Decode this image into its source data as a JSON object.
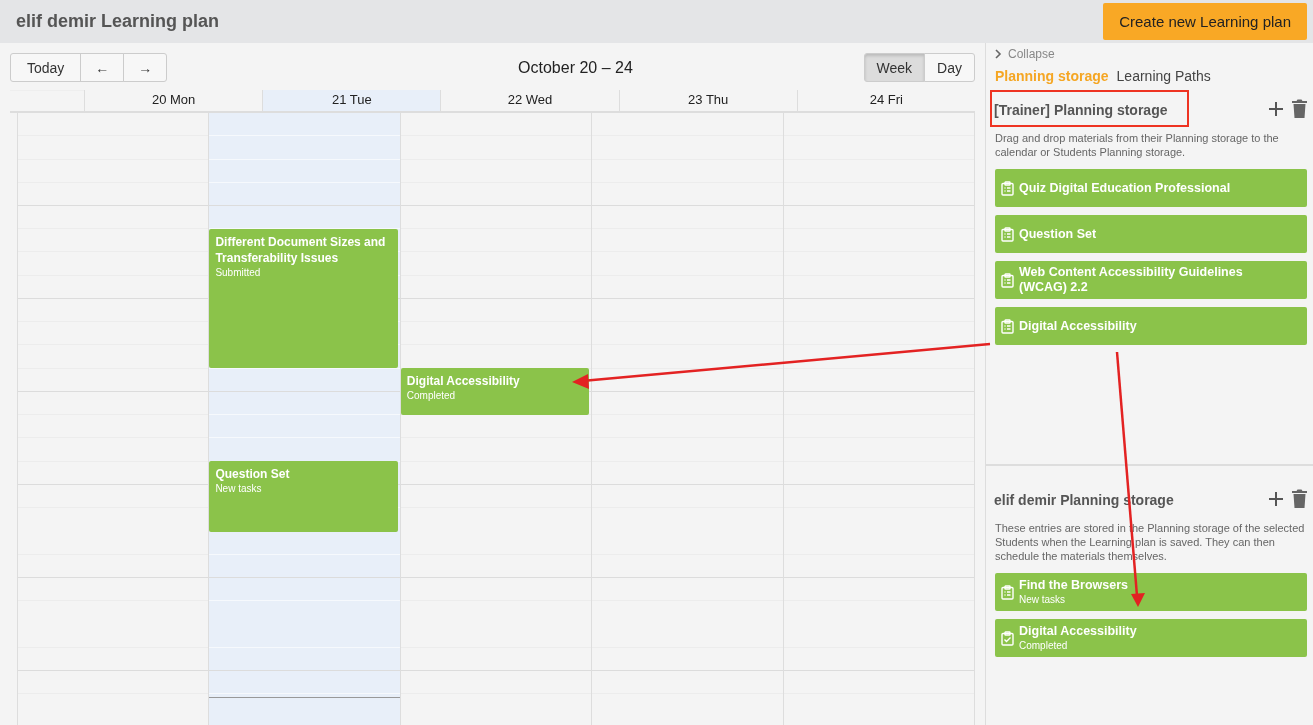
{
  "header": {
    "title": "elif demir Learning plan",
    "create_button": "Create new Learning plan"
  },
  "calendar": {
    "nav_buttons": [
      "Today",
      "←",
      "→"
    ],
    "range_title": "October 20 – 24",
    "views": [
      {
        "label": "Week",
        "selected": true
      },
      {
        "label": "Day",
        "selected": false
      }
    ],
    "days": [
      {
        "label": "20 Mon",
        "today": false
      },
      {
        "label": "21 Tue",
        "today": true,
        "events": [
          {
            "title": "Different Document Sizes and Transferability Issues",
            "status": "Submitted"
          },
          {
            "title": "Question Set",
            "status": "New tasks"
          }
        ]
      },
      {
        "label": "22 Wed",
        "today": false,
        "events": [
          {
            "title": "Digital Accessibility",
            "status": "Completed"
          }
        ]
      },
      {
        "label": "23 Thu",
        "today": false
      },
      {
        "label": "24 Fri",
        "today": false
      }
    ]
  },
  "side_panel": {
    "collapse": "Collapse",
    "tabs": [
      {
        "label": "Planning storage",
        "selected": true
      },
      {
        "label": "Learning Paths",
        "selected": false
      }
    ],
    "storages": [
      {
        "title": "[Trainer] Planning storage",
        "highlighted": true,
        "description": "Drag and drop materials from their Planning storage to the calendar or Students Planning storage.",
        "items": [
          {
            "kind": "list",
            "title": "Quiz Digital Education Professional"
          },
          {
            "kind": "list",
            "title": "Question Set"
          },
          {
            "kind": "list",
            "title": "Web Content Accessibility Guidelines (WCAG) 2.2"
          },
          {
            "kind": "list",
            "title": "Digital Accessibility"
          }
        ]
      },
      {
        "title": "elif demir Planning storage",
        "highlighted": false,
        "description": "These entries are stored in the Planning storage of the selected Students when the Learning plan is saved. They can then schedule the materials themselves.",
        "items": [
          {
            "kind": "list",
            "title": "Find the Browsers",
            "status": "New tasks"
          },
          {
            "kind": "done",
            "title": "Digital Accessibility",
            "status": "Completed"
          }
        ]
      }
    ]
  }
}
